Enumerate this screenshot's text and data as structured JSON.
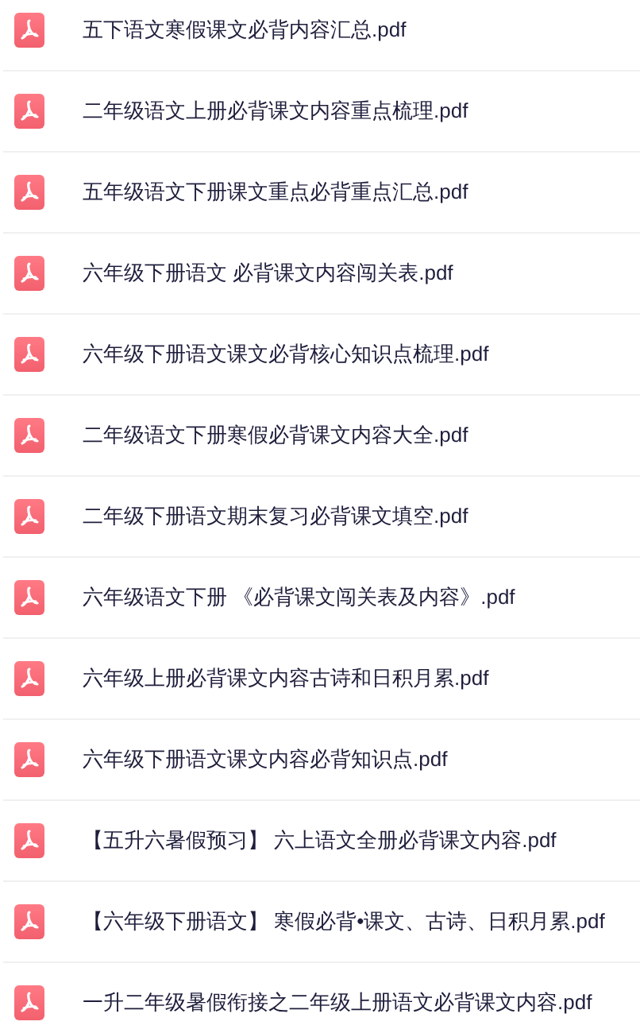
{
  "files": [
    {
      "name": "五下语文寒假课文必背内容汇总.pdf"
    },
    {
      "name": "二年级语文上册必背课文内容重点梳理.pdf"
    },
    {
      "name": "五年级语文下册课文重点必背重点汇总.pdf"
    },
    {
      "name": "六年级下册语文 必背课文内容闯关表.pdf"
    },
    {
      "name": "六年级下册语文课文必背核心知识点梳理.pdf"
    },
    {
      "name": "二年级语文下册寒假必背课文内容大全.pdf"
    },
    {
      "name": "二年级下册语文期末复习必背课文填空.pdf"
    },
    {
      "name": "六年级语文下册 《必背课文闯关表及内容》.pdf"
    },
    {
      "name": "六年级上册必背课文内容古诗和日积月累.pdf"
    },
    {
      "name": "六年级下册语文课文内容必背知识点.pdf"
    },
    {
      "name": "【五升六暑假预习】 六上语文全册必背课文内容.pdf"
    },
    {
      "name": "【六年级下册语文】 寒假必背•课文、古诗、日积月累.pdf"
    },
    {
      "name": "一升二年级暑假衔接之二年级上册语文必背课文内容.pdf"
    }
  ]
}
